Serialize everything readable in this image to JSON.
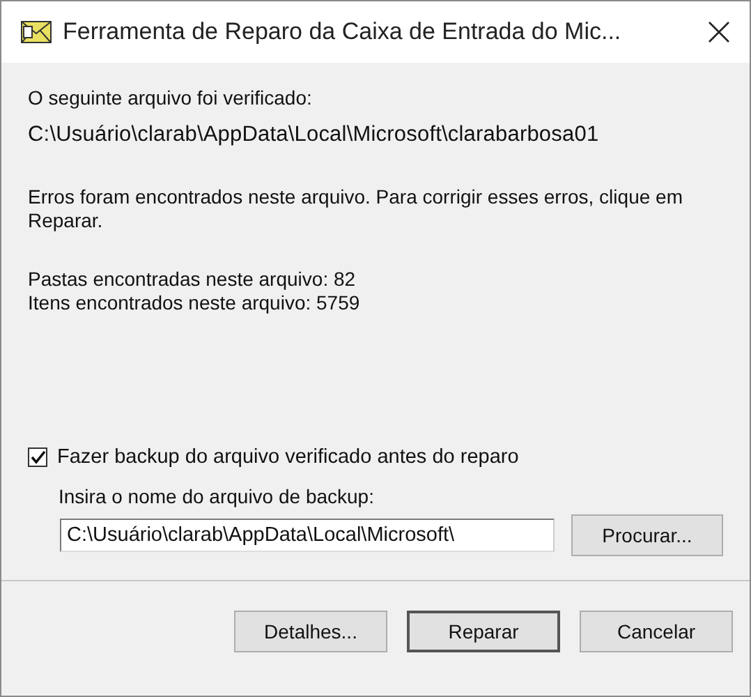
{
  "window": {
    "title": "Ferramenta de Reparo da Caixa de Entrada do Mic..."
  },
  "scanned_label": "O seguinte arquivo foi verificado:",
  "scanned_path": "C:\\Usuário\\clarab\\AppData\\Local\\Microsoft\\clarabarbosa01",
  "message": "Erros foram encontrados neste arquivo. Para corrigir esses erros, clique em Reparar.",
  "stats": [
    "Pastas encontradas neste arquivo: 82",
    "Itens encontrados neste arquivo: 5759"
  ],
  "backup_checkbox": {
    "label": "Fazer backup do arquivo verificado antes do reparo",
    "checked": true
  },
  "backup_field": {
    "label": "Insira o nome do arquivo de backup:",
    "value": "C:\\Usuário\\clarab\\AppData\\Local\\Microsoft\\"
  },
  "browse_button": "Procurar...",
  "buttons": [
    {
      "label": "Detalhes...",
      "default": false
    },
    {
      "label": "Reparar",
      "default": true
    },
    {
      "label": "Cancelar",
      "default": false
    }
  ]
}
